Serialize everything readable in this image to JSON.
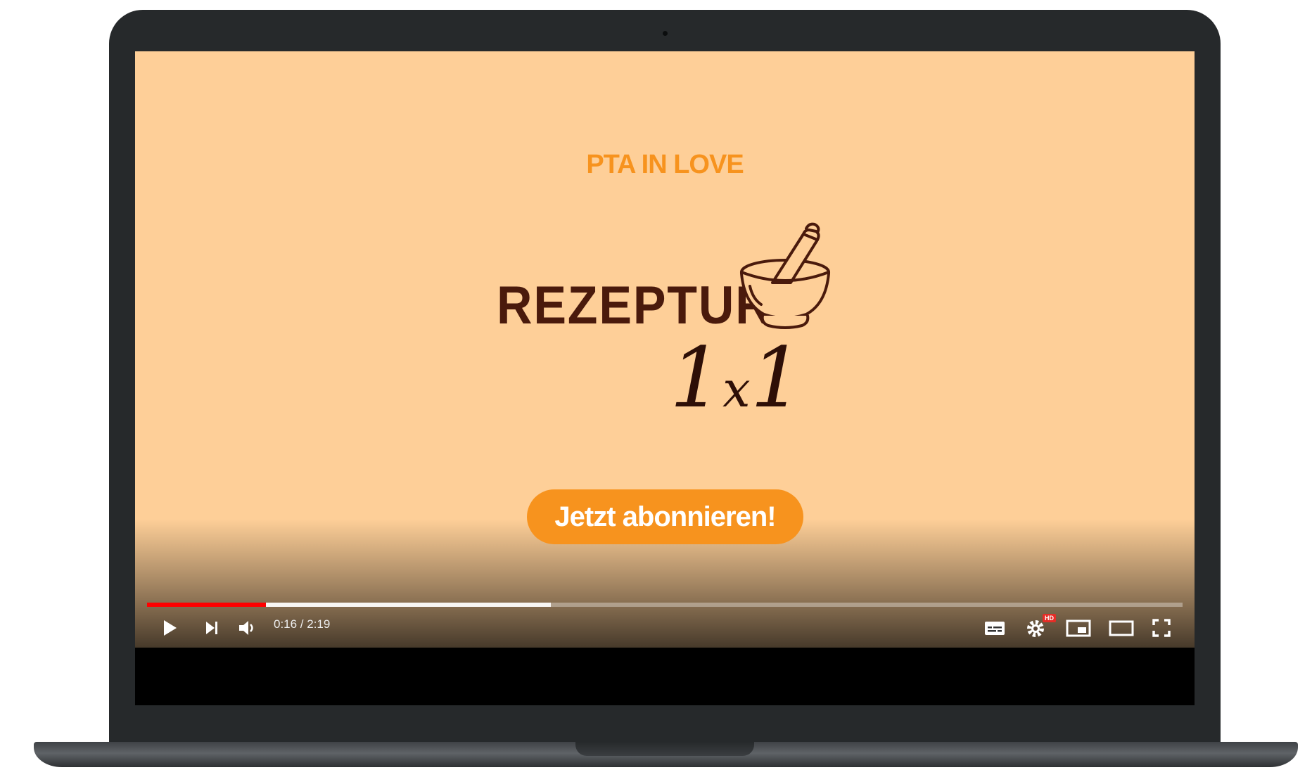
{
  "video": {
    "brand": "PTA IN LOVE",
    "title_word": "REZEPTUR",
    "title_one_left": "1",
    "title_x": "x",
    "title_one_right": "1",
    "cta_label": "Jetzt abonnieren!"
  },
  "player": {
    "time_display": "0:16 / 2:19",
    "current_time": "0:16",
    "duration": "2:19",
    "played_fraction": 0.115,
    "buffered_fraction": 0.39,
    "quality_badge": "HD",
    "icons": [
      "play-icon",
      "next-icon",
      "volume-icon",
      "subtitles-icon",
      "settings-icon",
      "miniplayer-icon",
      "theater-mode-icon",
      "fullscreen-icon"
    ]
  },
  "colors": {
    "video_background": "#fecf98",
    "accent_orange": "#f7931e",
    "title_brown": "#4a1a0c",
    "progress_red": "#ff0000",
    "laptop_body": "#26292b"
  }
}
